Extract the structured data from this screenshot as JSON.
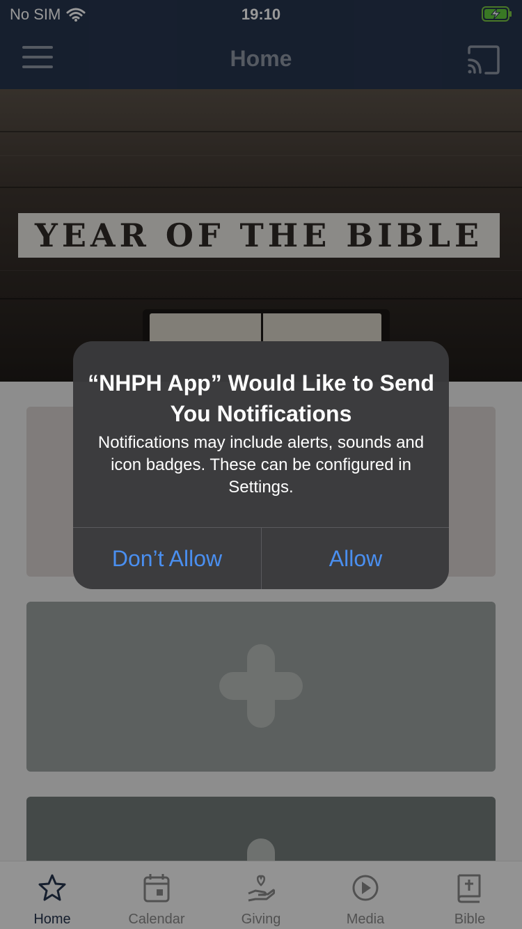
{
  "status_bar": {
    "carrier": "No SIM",
    "time": "19:10",
    "icons": [
      "wifi-icon",
      "battery-charging-icon"
    ]
  },
  "nav": {
    "title": "Home",
    "left_icon": "hamburger-menu-icon",
    "right_icon": "cast-icon"
  },
  "hero": {
    "banner_text": "YEAR OF THE BIBLE"
  },
  "cards": [
    {
      "placeholder_icon": "none"
    },
    {
      "placeholder_icon": "cross-icon"
    },
    {
      "placeholder_icon": "cross-icon"
    }
  ],
  "tabs": [
    {
      "label": "Home",
      "icon": "star-icon",
      "active": true
    },
    {
      "label": "Calendar",
      "icon": "calendar-icon",
      "active": false
    },
    {
      "label": "Giving",
      "icon": "giving-hand-icon",
      "active": false
    },
    {
      "label": "Media",
      "icon": "play-circle-icon",
      "active": false
    },
    {
      "label": "Bible",
      "icon": "bible-book-icon",
      "active": false
    }
  ],
  "alert": {
    "title": "“NHPH App” Would Like to Send You Notifications",
    "message": "Notifications may include alerts, sounds and icon badges. These can be configured in Settings.",
    "deny_label": "Don’t Allow",
    "allow_label": "Allow"
  },
  "colors": {
    "nav_bg": "#26344e",
    "accent_blue": "#4a8ff0",
    "alert_bg": "#3a3a3c"
  }
}
